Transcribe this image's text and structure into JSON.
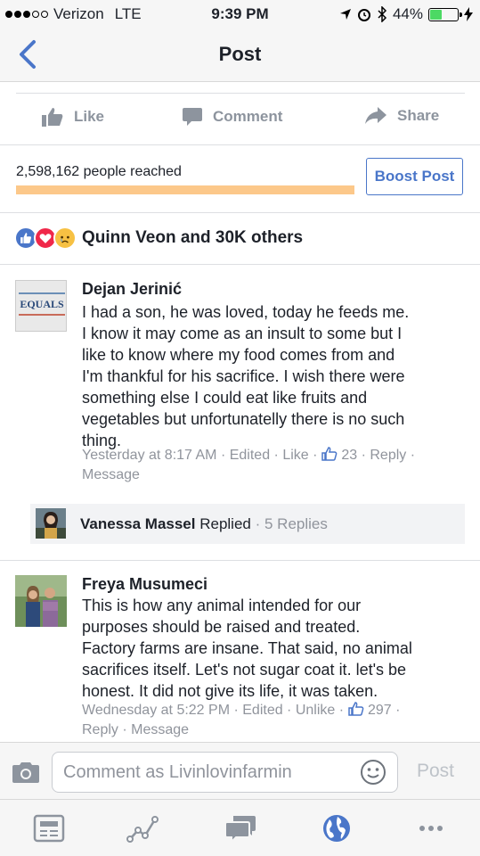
{
  "status_bar": {
    "carrier": "Verizon",
    "network": "LTE",
    "time": "9:39 PM",
    "battery": "44%",
    "battery_level": 0.44
  },
  "navbar": {
    "title": "Post"
  },
  "actions": {
    "like": "Like",
    "comment": "Comment",
    "share": "Share"
  },
  "reach": {
    "text": "2,598,162 people reached",
    "boost_label": "Boost Post"
  },
  "reactions": {
    "summary": "Quinn Veon and 30K others"
  },
  "comments": [
    {
      "author": "Dejan Jerinić",
      "avatar_text": "EQUALS",
      "lines": [
        "I had a son, he was loved, today he feeds me.",
        "I know it may come as an insult to some but I",
        "like to know where my food comes from and",
        "I'm thankful for his sacrifice. I wish there were",
        "something else I could eat like fruits and",
        "vegetables but unfortunatelly there is no such",
        "thing."
      ],
      "meta_line1": "Yesterday at 8:17 AM · Edited · Like · ",
      "likes": "23",
      "meta_tail": " · Reply ·",
      "meta_line2": "Message"
    },
    {
      "author": "Freya Musumeci",
      "lines": [
        "This is how any animal intended for our",
        "purposes should be raised and treated.",
        "Factory farms are insane. That said, no animal",
        "sacrifices itself. Let's not sugar coat it. let's be",
        "honest. It did not give its life, it was taken."
      ],
      "meta_line1": "Wednesday at 5:22 PM · Edited · Unlike · ",
      "likes": "297",
      "meta_tail": " ·",
      "meta_line2": "Reply · Message"
    }
  ],
  "reply_summary": {
    "name": "Vanessa Massel",
    "action": "Replied",
    "count": "· 5 Replies"
  },
  "composer": {
    "placeholder": "Comment as Livinlovinfarmin",
    "post_label": "Post"
  },
  "colors": {
    "accent": "#4a76c9",
    "reach_bar": "#fcc88a",
    "meta": "#90949c"
  }
}
